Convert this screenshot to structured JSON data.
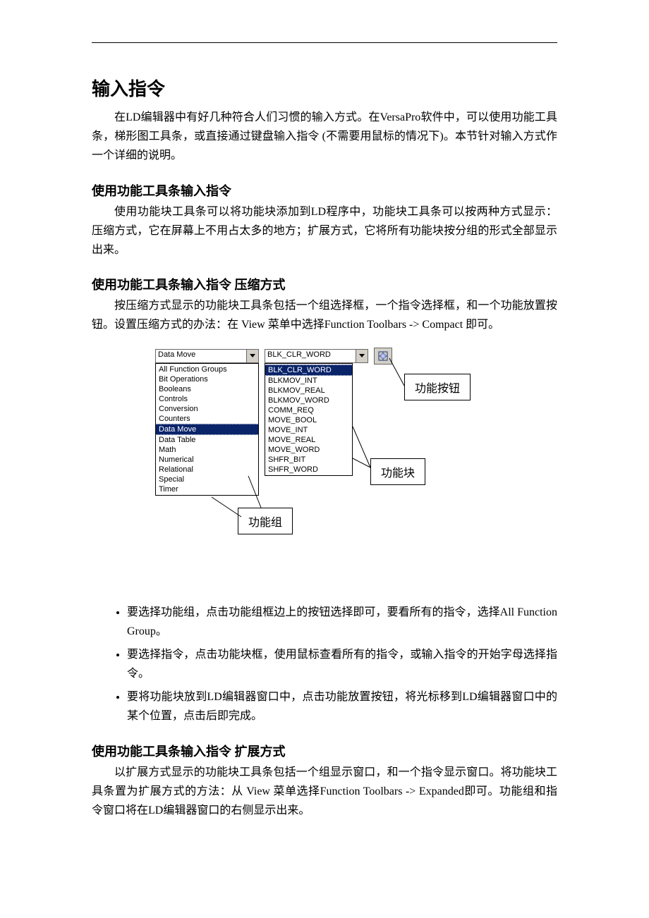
{
  "headings": {
    "h1": "输入指令",
    "h2a": "使用功能工具条输入指令",
    "h2b": "使用功能工具条输入指令 压缩方式",
    "h2c": "使用功能工具条输入指令 扩展方式"
  },
  "paras": {
    "p1": "在LD编辑器中有好几种符合人们习惯的输入方式。在VersaPro软件中，可以使用功能工具条，梯形图工具条，或直接通过键盘输入指令 (不需要用鼠标的情况下)。本节针对输入方式作一个详细的说明。",
    "p2": "使用功能块工具条可以将功能块添加到LD程序中，功能块工具条可以按两种方式显示：压缩方式，它在屏幕上不用占太多的地方；扩展方式，它将所有功能块按分组的形式全部显示出来。",
    "p3": "按压缩方式显示的功能块工具条包括一个组选择框，一个指令选择框，和一个功能放置按钮。设置压缩方式的办法：在 View 菜单中选择Function Toolbars -> Compact 即可。",
    "p4": "以扩展方式显示的功能块工具条包括一个组显示窗口，和一个指令显示窗口。将功能块工具条置为扩展方式的方法：从 View 菜单选择Function Toolbars -> Expanded即可。功能组和指令窗口将在LD编辑器窗口的右侧显示出来。"
  },
  "bullets": {
    "b1": "要选择功能组，点击功能组框边上的按钮选择即可，要看所有的指令，选择All Function Group。",
    "b2": "要选择指令，点击功能块框，使用鼠标查看所有的指令，或输入指令的开始字母选择指令。",
    "b3": "要将功能块放到LD编辑器窗口中，点击功能放置按钮，将光标移到LD编辑器窗口中的某个位置，点击后即完成。"
  },
  "figure": {
    "group_combo": "Data Move",
    "func_combo": "BLK_CLR_WORD",
    "groups": [
      "All Function Groups",
      "Bit Operations",
      "Booleans",
      "Controls",
      "Conversion",
      "Counters",
      "Data Move",
      "Data Table",
      "Math",
      "Numerical",
      "Relational",
      "Special",
      "Timer"
    ],
    "group_selected_index": 6,
    "funcs": [
      "BLK_CLR_WORD",
      "BLKMOV_INT",
      "BLKMOV_REAL",
      "BLKMOV_WORD",
      "COMM_REQ",
      "MOVE_BOOL",
      "MOVE_INT",
      "MOVE_REAL",
      "MOVE_WORD",
      "SHFR_BIT",
      "SHFR_WORD"
    ],
    "func_selected_index": 0,
    "callouts": {
      "btn": "功能按钮",
      "blk": "功能块",
      "grp": "功能组"
    }
  }
}
